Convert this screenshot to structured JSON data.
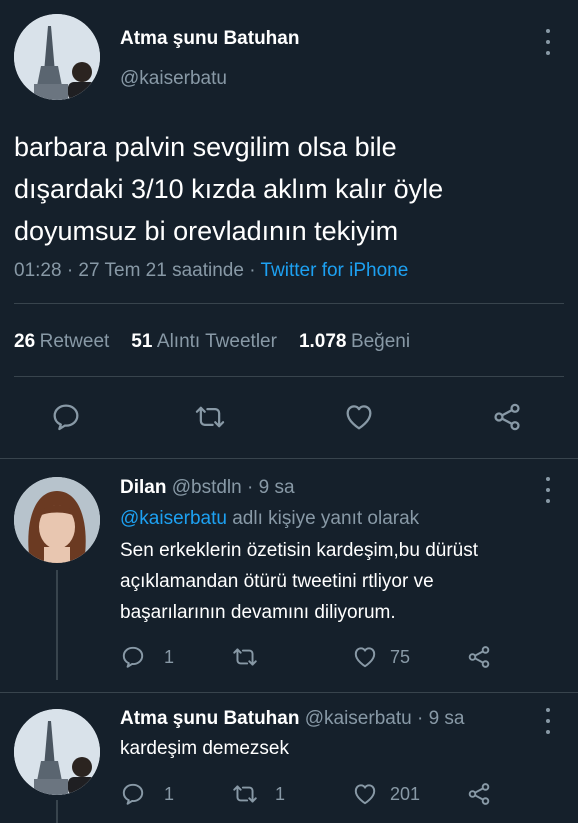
{
  "main_tweet": {
    "author_name": "Atma şunu Batuhan",
    "author_handle": "@kaiserbatu",
    "text_line1": "barbara palvin sevgilim olsa bile",
    "text_line2": "dışardaki 3/10 kızda aklım kalır öyle",
    "text_line3": "doyumsuz bi orevladının tekiyim",
    "time": "01:28 · 27 Tem 21 saatinde ·",
    "source": "Twitter for iPhone",
    "retweet_count": "26",
    "retweet_label": "Retweet",
    "quote_count": "51",
    "quote_label": "Alıntı Tweetler",
    "like_count": "1.078",
    "like_label": "Beğeni"
  },
  "replies": [
    {
      "author_name": "Dilan",
      "author_handle": "@bstdln",
      "age": "· 9 sa",
      "reply_to_handle": "@kaiserbatu",
      "reply_to_suffix": "adlı kişiye yanıt olarak",
      "text_line1": "Sen erkeklerin özetisin kardeşim,bu dürüst",
      "text_line2": "açıklamandan ötürü tweetini rtliyor ve",
      "text_line3": "başarılarının devamını diliyorum.",
      "reply_count": "1",
      "retweet_count": "",
      "like_count": "75"
    },
    {
      "author_name": "Atma şunu Batuhan",
      "author_handle": "@kaiserbatu",
      "age": "· 9 sa",
      "text_line1": "kardeşim demezsek",
      "reply_count": "1",
      "retweet_count": "1",
      "like_count": "201"
    }
  ],
  "icons": {
    "reply": "reply-icon",
    "retweet": "retweet-icon",
    "like": "heart-icon",
    "share": "share-icon",
    "more": "more-vertical-icon"
  },
  "colors": {
    "background": "#15202b",
    "accent": "#1da1f2",
    "muted": "#8899a6",
    "divider": "#38444d"
  }
}
